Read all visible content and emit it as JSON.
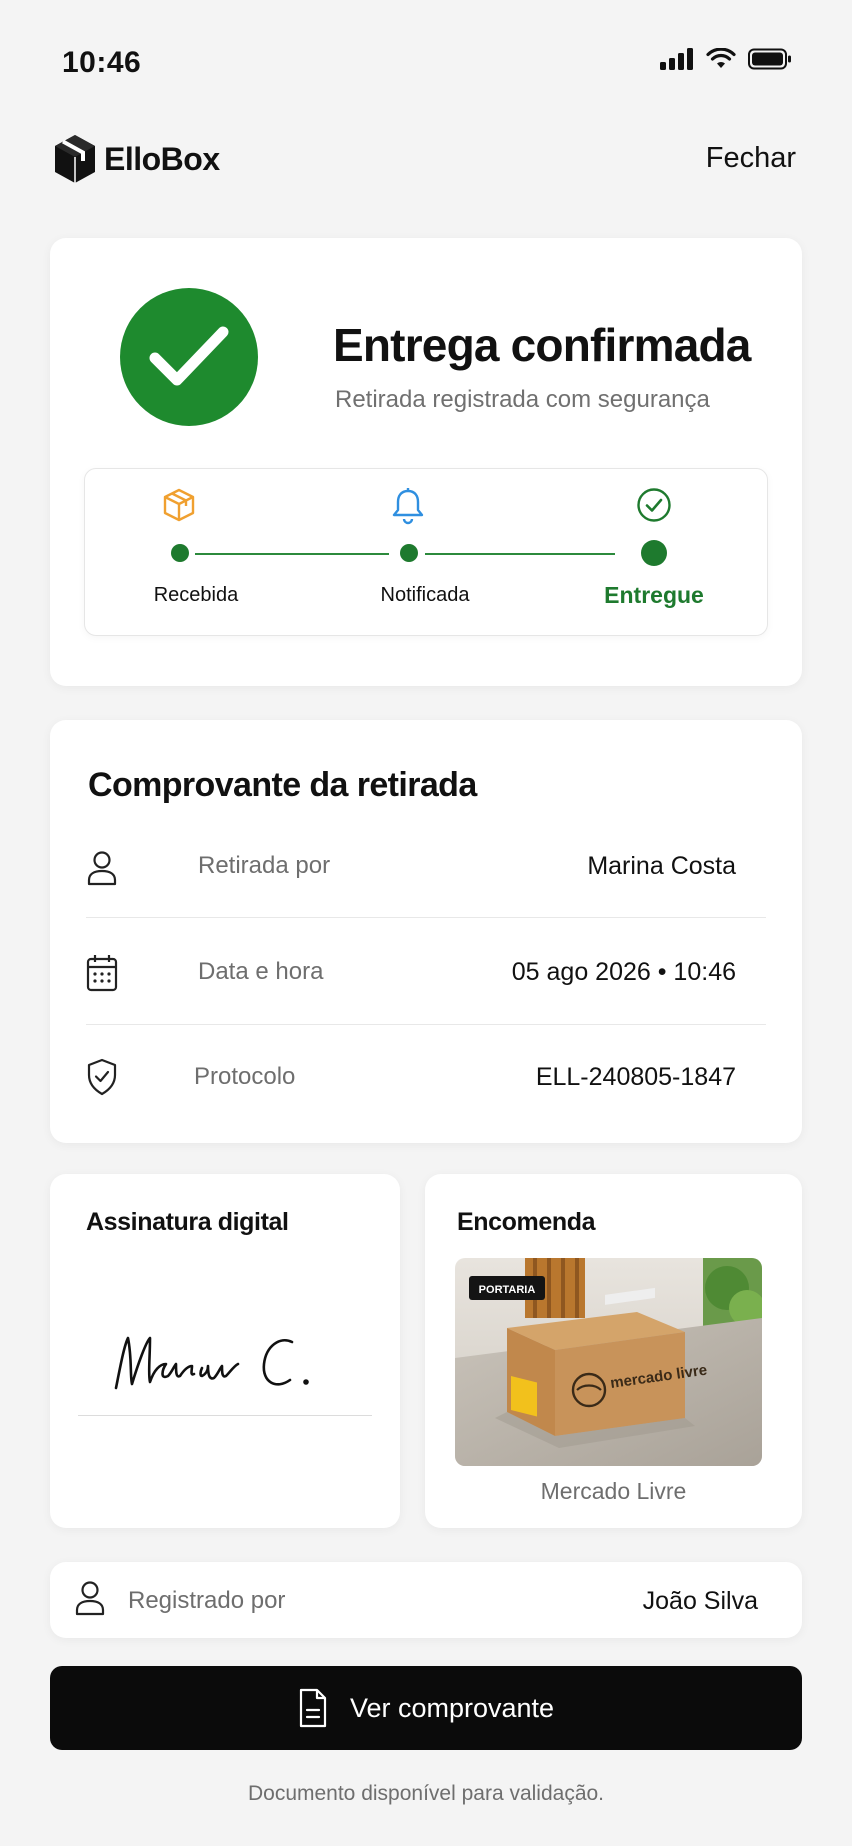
{
  "status_bar": {
    "time": "10:46"
  },
  "header": {
    "brand": "ElloBox",
    "close_label": "Fechar"
  },
  "hero": {
    "title": "Entrega confirmada",
    "subtitle": "Retirada registrada com segurança",
    "accent_color": "#1e8a2e",
    "steps": [
      {
        "label": "Recebida",
        "icon": "package-icon",
        "icon_color": "#f0a030"
      },
      {
        "label": "Notificada",
        "icon": "bell-icon",
        "icon_color": "#2f8fe0"
      },
      {
        "label": "Entregue",
        "icon": "check-circle-icon",
        "icon_color": "#1e7a2e",
        "active": true
      }
    ]
  },
  "receipt": {
    "title": "Comprovante da retirada",
    "rows": [
      {
        "icon": "user-icon",
        "label": "Retirada por",
        "value": "Marina Costa"
      },
      {
        "icon": "calendar-icon",
        "label": "Data e hora",
        "value": "05 ago 2026 • 10:46"
      },
      {
        "icon": "shield-check-icon",
        "label": "Protocolo",
        "value": "ELL-240805-1847"
      }
    ]
  },
  "signature": {
    "title": "Assinatura digital",
    "signature_text": "Marina C."
  },
  "package": {
    "title": "Encomenda",
    "caption": "Mercado Livre",
    "photo_sign": "PORTARIA",
    "box_logo": "mercado livre"
  },
  "registered_by": {
    "icon": "user-icon",
    "label": "Registrado por",
    "value": "João Silva"
  },
  "cta": {
    "icon": "document-icon",
    "label": "Ver comprovante"
  },
  "footnote": "Documento disponível para validação."
}
